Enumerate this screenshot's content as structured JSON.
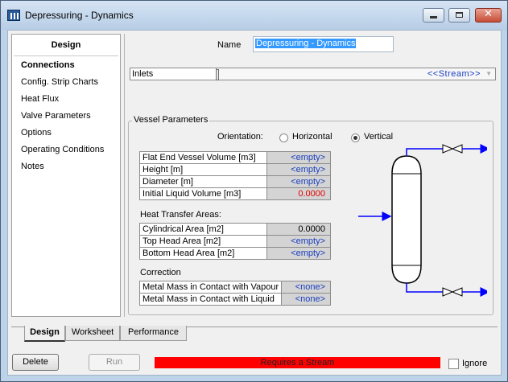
{
  "window": {
    "title": "Depressuring - Dynamics",
    "close_glyph": "✕"
  },
  "sidebar": {
    "title": "Design",
    "items": [
      {
        "label": "Connections",
        "active": true
      },
      {
        "label": "Config. Strip Charts"
      },
      {
        "label": "Heat Flux"
      },
      {
        "label": "Valve Parameters"
      },
      {
        "label": "Options"
      },
      {
        "label": "Operating Conditions"
      },
      {
        "label": "Notes"
      }
    ]
  },
  "name": {
    "label": "Name",
    "value": "Depressuring - Dynamics"
  },
  "inlets": {
    "label": "Inlets",
    "placeholder": "<<Stream>>",
    "arrow": "▼"
  },
  "vessel_parameters": {
    "title": "Vessel Parameters",
    "orientation_label": "Orientation:",
    "orientation_options": [
      "Horizontal",
      "Vertical"
    ],
    "orientation_selected": "Vertical",
    "rows": [
      {
        "label": "Flat End Vessel Volume [m3]",
        "value": "<empty>"
      },
      {
        "label": "Height [m]",
        "value": "<empty>"
      },
      {
        "label": "Diameter [m]",
        "value": "<empty>"
      },
      {
        "label": "Initial Liquid Volume [m3]",
        "value": "0.0000"
      }
    ],
    "heat_transfer": {
      "title": "Heat Transfer Areas:",
      "rows": [
        {
          "label": "Cylindrical Area [m2]",
          "value": "0.0000"
        },
        {
          "label": "Top Head Area [m2]",
          "value": "<empty>"
        },
        {
          "label": "Bottom Head Area [m2]",
          "value": "<empty>"
        }
      ]
    },
    "correction": {
      "title": "Correction",
      "rows": [
        {
          "label": "Metal Mass in Contact with Vapour",
          "value": "<none>"
        },
        {
          "label": "Metal Mass in Contact with Liquid",
          "value": "<none>"
        }
      ]
    }
  },
  "tabs": [
    "Design",
    "Worksheet",
    "Performance"
  ],
  "active_tab": "Design",
  "buttons": {
    "delete": "Delete",
    "run": "Run"
  },
  "status": {
    "text": "Requires a Stream",
    "color": "#ff0000"
  },
  "ignore": {
    "label": "Ignore",
    "checked": false
  },
  "colors": {
    "selection": "#3399ff",
    "link_value": "#1a3fbf",
    "flow_arrow": "#0000ff"
  }
}
